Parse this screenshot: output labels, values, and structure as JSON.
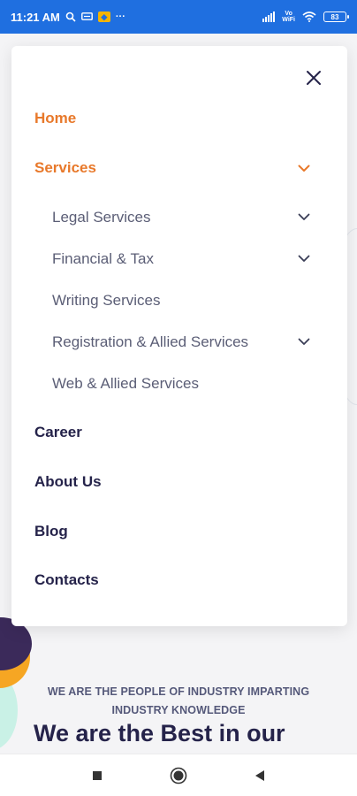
{
  "status_bar": {
    "time": "11:21 AM",
    "volte": "Vo\nWiFi",
    "battery": "83"
  },
  "menu": {
    "items": [
      {
        "label": "Home"
      },
      {
        "label": "Services"
      },
      {
        "label": "Career"
      },
      {
        "label": "About Us"
      },
      {
        "label": "Blog"
      },
      {
        "label": "Contacts"
      }
    ],
    "services_submenu": [
      {
        "label": "Legal Services"
      },
      {
        "label": "Financial & Tax"
      },
      {
        "label": "Writing Services"
      },
      {
        "label": "Registration & Allied Services"
      },
      {
        "label": "Web & Allied Services"
      }
    ]
  },
  "page": {
    "tagline": "WE ARE THE PEOPLE OF INDUSTRY IMPARTING INDUSTRY KNOWLEDGE",
    "heading": "We are the Best in our"
  },
  "colors": {
    "accent": "#e8792b",
    "text_dark": "#25234a",
    "status_bar": "#1f6fe0"
  },
  "icons": {
    "close": "close-icon",
    "chevron": "chevron-down-icon",
    "nav_recents": "square-icon",
    "nav_home": "circle-icon",
    "nav_back": "triangle-back-icon"
  }
}
